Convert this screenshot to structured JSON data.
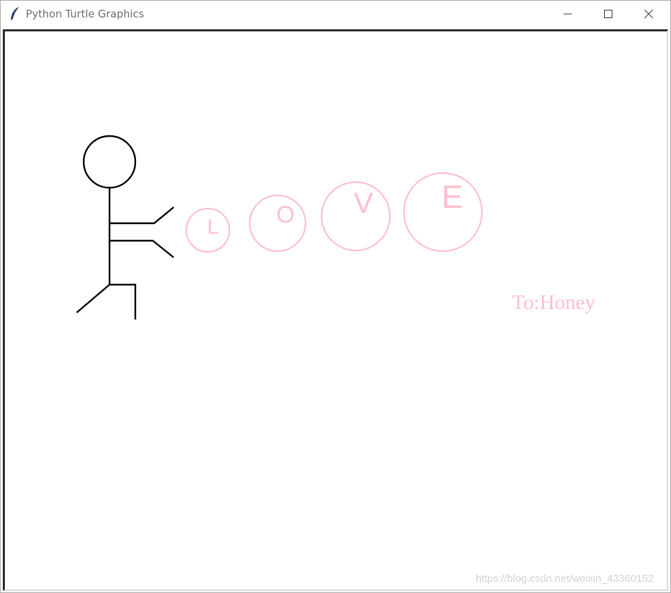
{
  "window": {
    "title": "Python Turtle Graphics",
    "icon": "feather-icon",
    "controls": {
      "minimize_icon": "minimize-icon",
      "maximize_icon": "maximize-icon",
      "close_icon": "close-icon"
    }
  },
  "canvas": {
    "letters": [
      "L",
      "O",
      "V",
      "E"
    ],
    "dedication": "To:Honey",
    "figure": "stick-figure",
    "colors": {
      "figure_stroke": "#000000",
      "love_pink": "#ffc0cb",
      "background": "#ffffff"
    }
  },
  "watermark": "https://blog.csdn.net/weixin_43360152"
}
